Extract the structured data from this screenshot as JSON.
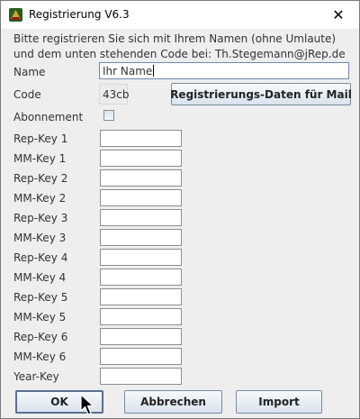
{
  "window": {
    "title": "Registrierung V6.3",
    "close_glyph": "✕"
  },
  "intro": {
    "line1": "Bitte registrieren Sie sich mit Ihrem Namen (ohne Umlaute)",
    "line2": "und dem unten stehenden Code bei: Th.Stegemann@jRep.de"
  },
  "name": {
    "label": "Name",
    "value": "Ihr Name"
  },
  "code": {
    "label": "Code",
    "value": "43cb"
  },
  "mail_button": {
    "label": "Registrierungs-Daten für Mail"
  },
  "subscription": {
    "label": "Abonnement",
    "checked": false
  },
  "keys": [
    {
      "label": "Rep-Key 1",
      "value": ""
    },
    {
      "label": "MM-Key 1",
      "value": ""
    },
    {
      "label": "Rep-Key 2",
      "value": ""
    },
    {
      "label": "MM-Key 2",
      "value": ""
    },
    {
      "label": "Rep-Key 3",
      "value": ""
    },
    {
      "label": "MM-Key 3",
      "value": ""
    },
    {
      "label": "Rep-Key 4",
      "value": ""
    },
    {
      "label": "MM-Key 4",
      "value": ""
    },
    {
      "label": "Rep-Key 5",
      "value": ""
    },
    {
      "label": "MM-Key 5",
      "value": ""
    },
    {
      "label": "Rep-Key 6",
      "value": ""
    },
    {
      "label": "MM-Key 6",
      "value": ""
    },
    {
      "label": "Year-Key",
      "value": ""
    }
  ],
  "buttons": {
    "ok": "OK",
    "cancel": "Abbrechen",
    "import": "Import"
  },
  "colors": {
    "dialog_bg": "#eeeeee",
    "button_gradient_top": "#f6f9fc",
    "button_gradient_bottom": "#d9e3ee",
    "button_border": "#7a8aa0"
  },
  "icons": {
    "app": "jrep-app-icon",
    "close": "close-icon",
    "pointer": "mouse-pointer-icon"
  }
}
